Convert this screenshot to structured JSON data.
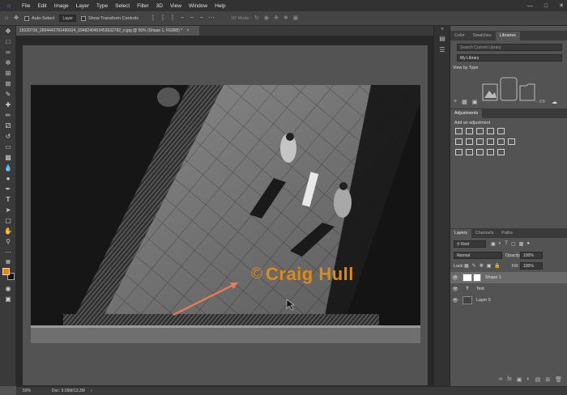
{
  "menubar": {
    "items": [
      "File",
      "Edit",
      "Image",
      "Layer",
      "Type",
      "Select",
      "Filter",
      "3D",
      "View",
      "Window",
      "Help"
    ],
    "window_controls": [
      "—",
      "□",
      "✕"
    ]
  },
  "options": {
    "auto_select_label": "Auto-Select",
    "auto_select_value": "Layer",
    "transform_label": "Show Transform Controls",
    "mode_3d": "3D Mode:"
  },
  "document": {
    "tab_title": "18320736_2894442781490924_6948240453453632782_o.jpg @ 50% (Shape 1, RGB/8) *",
    "close": "×"
  },
  "watermark": {
    "symbol": "©",
    "text": "Craig Hull",
    "color": "#e08a15"
  },
  "arrow_color": "#f07a55",
  "panels": {
    "top_tabs": [
      "Color",
      "Swatches",
      "Libraries"
    ],
    "search_placeholder": "Search Current Library",
    "library_name": "My Library",
    "view_by": "View by Type",
    "kb": "-- KB",
    "adjustments_title": "Adjustments",
    "add_adjustment": "Add an adjustment",
    "layer_tabs": [
      "Layers",
      "Channels",
      "Paths"
    ],
    "kind": "Kind",
    "blend_mode": "Normal",
    "opacity_label": "Opacity:",
    "opacity_value": "100%",
    "lock_label": "Lock:",
    "fill_label": "Fill:",
    "fill_value": "100%",
    "layers": [
      {
        "name": "Shape 1",
        "selected": true
      },
      {
        "name": "Text",
        "selected": false
      },
      {
        "name": "Layer 0",
        "selected": false
      }
    ]
  },
  "status": {
    "zoom": "50%",
    "doc": "Doc: 9.09M/13.3M"
  }
}
